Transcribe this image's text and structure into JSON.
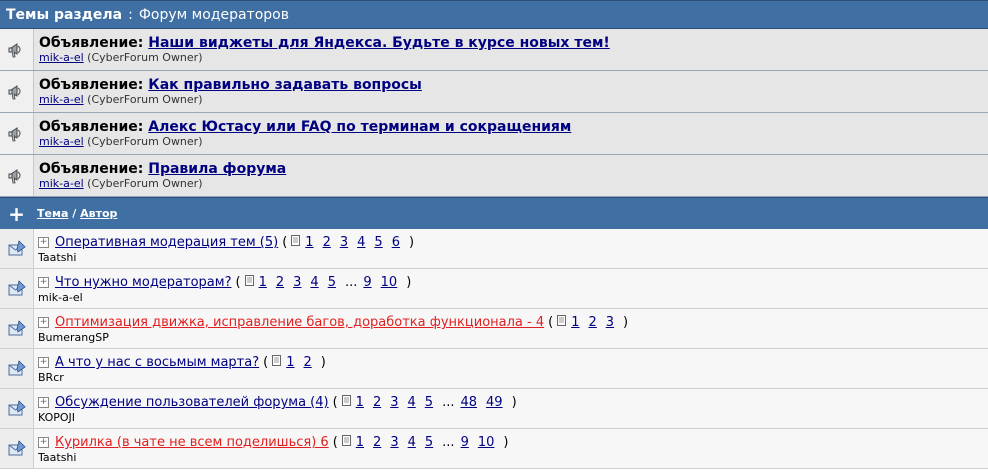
{
  "header": {
    "title": "Темы раздела",
    "sep": ":",
    "forum": "Форум модераторов"
  },
  "announcements": [
    {
      "prefix": "Объявление:",
      "title": "Наши виджеты для Яндекса. Будьте в курсе новых тем!",
      "author": "mik-a-el",
      "role": "(CyberForum Owner)"
    },
    {
      "prefix": "Объявление:",
      "title": "Как правильно задавать вопросы",
      "author": "mik-a-el",
      "role": "(CyberForum Owner)"
    },
    {
      "prefix": "Объявление:",
      "title": "Алекс Юстасу или FAQ по терминам и сокращениям",
      "author": "mik-a-el",
      "role": "(CyberForum Owner)"
    },
    {
      "prefix": "Объявление:",
      "title": "Правила форума",
      "author": "mik-a-el",
      "role": "(CyberForum Owner)"
    }
  ],
  "columns": {
    "plus": "+",
    "topic": "Тема",
    "slash": "/",
    "author": "Автор"
  },
  "threads": [
    {
      "title": "Оперативная модерация тем (5)",
      "hot": false,
      "author": "Taatshi",
      "pages": [
        "1",
        "2",
        "3",
        "4",
        "5",
        "6"
      ]
    },
    {
      "title": "Что нужно модераторам?",
      "hot": false,
      "author": "mik-a-el",
      "pages": [
        "1",
        "2",
        "3",
        "4",
        "5",
        "...",
        "9",
        "10"
      ]
    },
    {
      "title": "Оптимизация движка, исправление багов, доработка функционала - 4",
      "hot": true,
      "author": "BumerangSP",
      "pages": [
        "1",
        "2",
        "3"
      ]
    },
    {
      "title": "А что у нас с восьмым марта?",
      "hot": false,
      "author": "BRcr",
      "pages": [
        "1",
        "2"
      ]
    },
    {
      "title": "Обсуждение пользователей форума (4)",
      "hot": false,
      "author": "KOPOJI",
      "pages": [
        "1",
        "2",
        "3",
        "4",
        "5",
        "...",
        "48",
        "49"
      ]
    },
    {
      "title": "Курилка (в чате не всем поделишься) 6",
      "hot": true,
      "author": "Taatshi",
      "pages": [
        "1",
        "2",
        "3",
        "4",
        "5",
        "...",
        "9",
        "10"
      ]
    }
  ],
  "icons": {
    "announcement": "megaphone-icon",
    "thread": "thread-icon",
    "expand": "expand-icon",
    "pages": "multipage-icon"
  }
}
